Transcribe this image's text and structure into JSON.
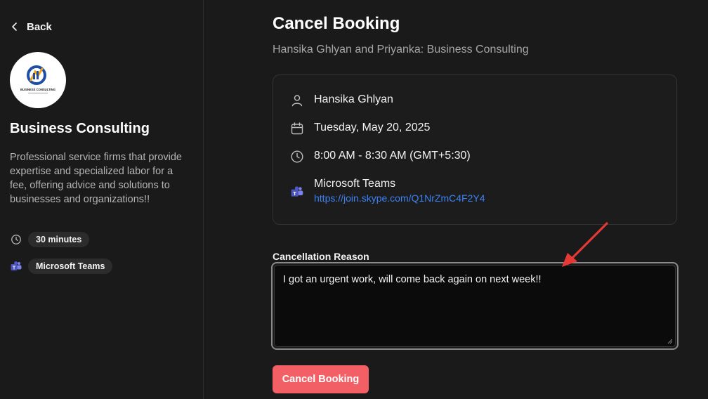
{
  "sidebar": {
    "back_label": "Back",
    "logo_text": "BUSINESS CONSULTING",
    "event_title": "Business Consulting",
    "event_description": "Professional service firms that provide expertise and specialized labor for a fee, offering advice and solutions to businesses and organizations!!",
    "duration_label": "30 minutes",
    "location_label": "Microsoft Teams"
  },
  "main": {
    "title": "Cancel Booking",
    "subtitle": "Hansika Ghlyan and Priyanka: Business Consulting",
    "details": {
      "attendee": "Hansika Ghlyan",
      "date": "Tuesday, May 20, 2025",
      "time": "8:00 AM - 8:30 AM (GMT+5:30)",
      "location": "Microsoft Teams",
      "meeting_link": "https://join.skype.com/Q1NrZmC4F2Y4"
    },
    "reason_label": "Cancellation Reason",
    "reason_value": "I got an urgent work, will come back again on next week!!",
    "cancel_button_label": "Cancel Booking"
  },
  "colors": {
    "background": "#1a1a1a",
    "accent_button": "#f26066",
    "link": "#3b82f6",
    "annotation_arrow": "#e53935"
  }
}
